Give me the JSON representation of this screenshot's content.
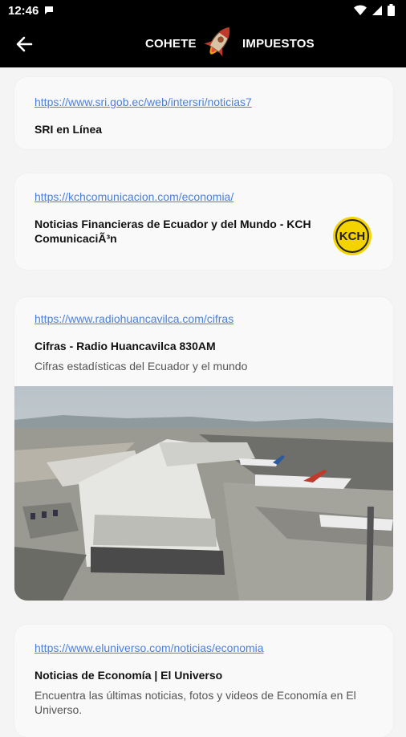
{
  "status_bar": {
    "time": "12:46",
    "icons": [
      "message-icon",
      "wifi-icon",
      "signal-icon",
      "battery-icon"
    ]
  },
  "app_bar": {
    "title_left": "COHETE",
    "title_right": "IMPUESTOS",
    "back_icon": "arrow-left-icon",
    "logo_icon": "rocket-icon"
  },
  "cards": [
    {
      "link": "https://www.sri.gob.ec/web/intersri/noticias7",
      "title": "SRI en Línea",
      "description": ""
    },
    {
      "link": "https://kchcomunicacion.com/economia/",
      "title": "Noticias Financieras de Ecuador y del Mundo - KCH ComunicaciÃ³n",
      "description": "",
      "logo_text": "KCH"
    },
    {
      "link": "https://www.radiohuancavilca.com/cifras",
      "title": "Cifras - Radio Huancavilca 830AM",
      "description": "Cifras estadísticas del Ecuador y el mundo",
      "image": "airport-photo"
    },
    {
      "link": "https://www.eluniverso.com/noticias/economia",
      "title": "Noticias de Economía | El Universo",
      "description": "Encuentra las últimas noticias, fotos y videos de Economía en El Universo."
    }
  ],
  "colors": {
    "link": "#4a7fe0",
    "app_bar_bg": "#000000",
    "page_bg": "#f4f4f4",
    "logo_yellow": "#f5d300"
  }
}
